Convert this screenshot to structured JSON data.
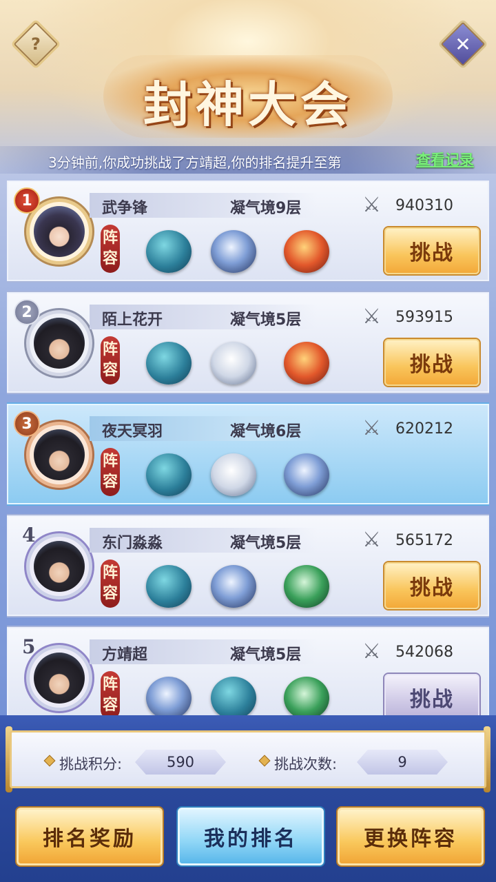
{
  "header": {
    "title": "封神大会",
    "help_icon": "?",
    "close_icon": "✕"
  },
  "notice": {
    "text": "3分钟前,你成功挑战了方靖超,你的排名提升至第",
    "log_link": "查看记录"
  },
  "rows": [
    {
      "rank": "1",
      "name": "武争锋",
      "realm": "凝气境9层",
      "power": "940310",
      "lineup_label_1": "阵",
      "lineup_label_2": "容",
      "pets": [
        "whale",
        "dragon-blue",
        "dragon-red"
      ],
      "button": "挑战",
      "button_state": "enabled",
      "is_me": false
    },
    {
      "rank": "2",
      "name": "陌上花开",
      "realm": "凝气境5层",
      "power": "593915",
      "lineup_label_1": "阵",
      "lineup_label_2": "容",
      "pets": [
        "whale",
        "tiger",
        "dragon-red"
      ],
      "button": "挑战",
      "button_state": "enabled",
      "is_me": false
    },
    {
      "rank": "3",
      "name": "夜天冥羽",
      "realm": "凝气境6层",
      "power": "620212",
      "lineup_label_1": "阵",
      "lineup_label_2": "容",
      "pets": [
        "whale",
        "tiger",
        "dragon-blue"
      ],
      "is_me": true
    },
    {
      "rank": "4",
      "name": "东门淼淼",
      "realm": "凝气境5层",
      "power": "565172",
      "lineup_label_1": "阵",
      "lineup_label_2": "容",
      "pets": [
        "whale",
        "dragon-blue",
        "dragon-green"
      ],
      "button": "挑战",
      "button_state": "enabled",
      "is_me": false
    },
    {
      "rank": "5",
      "name": "方靖超",
      "realm": "凝气境5层",
      "power": "542068",
      "lineup_label_1": "阵",
      "lineup_label_2": "容",
      "pets": [
        "dragon-blue",
        "whale",
        "dragon-green"
      ],
      "button": "挑战",
      "button_state": "disabled",
      "is_me": false
    }
  ],
  "stats": {
    "points_label": "挑战积分:",
    "points_value": "590",
    "count_label": "挑战次数:",
    "count_value": "9"
  },
  "buttons": {
    "rank_reward": "排名奖励",
    "my_rank": "我的排名",
    "change_lineup": "更换阵容"
  },
  "colors": {
    "accent_gold": "#f9c55b",
    "self_row": "#8ccbf1",
    "log_link": "#7af07a"
  }
}
